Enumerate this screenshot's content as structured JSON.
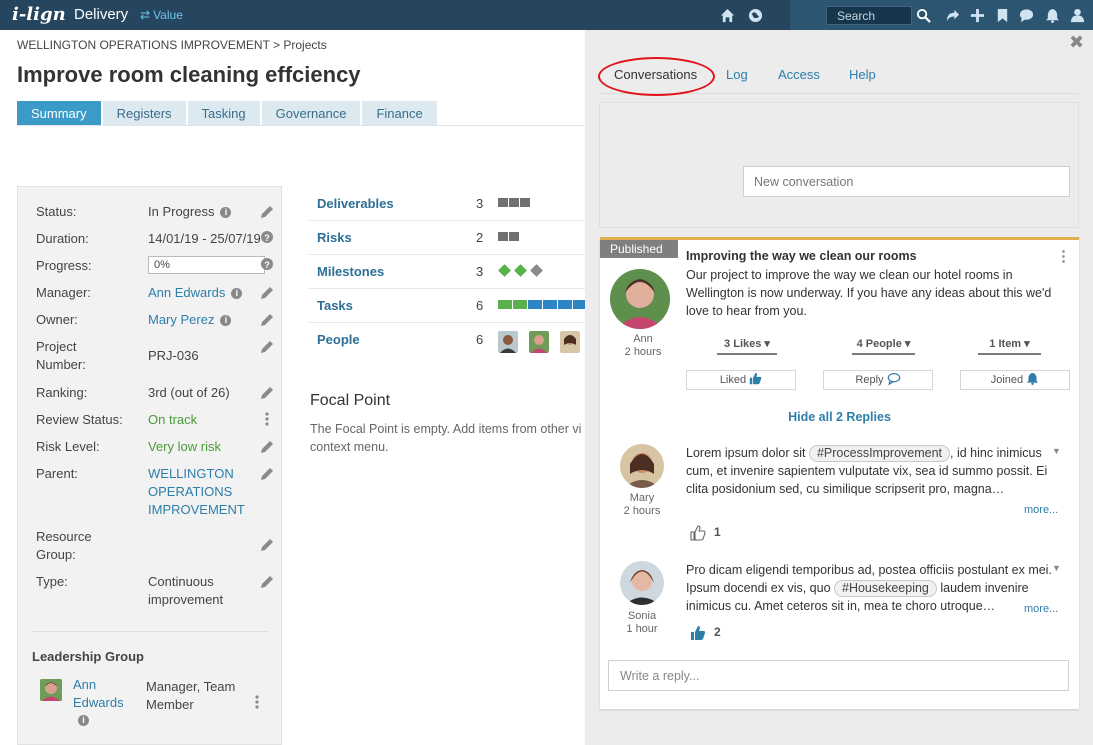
{
  "topbar": {
    "logo": "i-lign",
    "app_name": "Delivery",
    "value_label": "Value",
    "value_icon": "swap-arrows-icon",
    "search_placeholder": "Search",
    "icons": [
      "home-icon",
      "globe-icon",
      "search-icon",
      "share-icon",
      "plus-icon",
      "bookmark-icon",
      "chat-icon",
      "bell-icon",
      "user-icon"
    ]
  },
  "breadcrumb": "WELLINGTON OPERATIONS IMPROVEMENT > Projects",
  "page_title": "Improve room cleaning effciency",
  "tabs": [
    {
      "label": "Summary",
      "active": true
    },
    {
      "label": "Registers"
    },
    {
      "label": "Tasking"
    },
    {
      "label": "Governance"
    },
    {
      "label": "Finance"
    }
  ],
  "properties": {
    "status": {
      "label": "Status:",
      "value": "In Progress"
    },
    "duration": {
      "label": "Duration:",
      "value": "14/01/19 - 25/07/19"
    },
    "progress": {
      "label": "Progress:",
      "value": "0%"
    },
    "manager": {
      "label": "Manager:",
      "value": "Ann Edwards"
    },
    "owner": {
      "label": "Owner:",
      "value": "Mary Perez"
    },
    "project_number": {
      "label": "Project Number:",
      "value": "PRJ-036"
    },
    "ranking": {
      "label": "Ranking:",
      "value": "3rd (out of 26)"
    },
    "review_status": {
      "label": "Review Status:",
      "value": "On track"
    },
    "risk_level": {
      "label": "Risk Level:",
      "value": "Very low risk"
    },
    "parent": {
      "label": "Parent:",
      "value": "WELLINGTON OPERATIONS IMPROVEMENT"
    },
    "resource_group": {
      "label": "Resource Group:",
      "value": ""
    },
    "type": {
      "label": "Type:",
      "value": "Continuous improvement"
    }
  },
  "leadership": {
    "title": "Leadership Group",
    "member_name": "Ann Edwards",
    "member_role": "Manager, Team Member"
  },
  "summary_list": [
    {
      "label": "Deliverables",
      "count": "3"
    },
    {
      "label": "Risks",
      "count": "2"
    },
    {
      "label": "Milestones",
      "count": "3"
    },
    {
      "label": "Tasks",
      "count": "6"
    },
    {
      "label": "People",
      "count": "6"
    }
  ],
  "focal_point": {
    "title": "Focal Point",
    "text": "The Focal Point is empty. Add items from other vi context menu."
  },
  "panel": {
    "close_icon": "close-icon",
    "tabs": [
      {
        "label": "Conversations",
        "active": true
      },
      {
        "label": "Log"
      },
      {
        "label": "Access"
      },
      {
        "label": "Help"
      }
    ],
    "new_conversation_placeholder": "New conversation",
    "post": {
      "badge": "Published",
      "title": "Improving the way we clean our rooms",
      "body": "Our project to improve the way we clean our hotel rooms in Wellington is now underway.  If you have any ideas about this we'd love to hear from you.",
      "author": "Ann",
      "time": "2 hours",
      "likes_label": "3 Likes",
      "people_label": "4 People",
      "items_label": "1 Item",
      "liked_label": "Liked",
      "reply_label": "Reply",
      "joined_label": "Joined",
      "hide_replies": "Hide all 2 Replies"
    },
    "replies": [
      {
        "author": "Mary",
        "time": "2 hours",
        "text_before": "Lorem ipsum dolor sit ",
        "tag": "#ProcessImprovement",
        "text_after": ", id hinc inimicus cum, et invenire sapientem vulputate vix, sea id summo possit. Ei clita posidonium sed, cu similique scripserit pro, magna…",
        "more": "more...",
        "likes": "1"
      },
      {
        "author": "Sonia",
        "time": "1 hour",
        "text_before": "Pro dicam eligendi temporibus ad, postea officiis postulant ex mei. Ipsum docendi ex vis, quo ",
        "tag": "#Housekeeping",
        "text_after": " laudem invenire inimicus cu. Amet ceteros sit in, mea te choro utroque…",
        "more": "more...",
        "likes": "2"
      }
    ],
    "write_reply_placeholder": "Write a reply..."
  },
  "colors": {
    "topbar": "#26465f",
    "accent_blue": "#3a9bc8",
    "link": "#2d7ea9",
    "green": "#4a9a3a",
    "highlight_oval": "#e0131a",
    "published_border": "#e2b04a"
  }
}
